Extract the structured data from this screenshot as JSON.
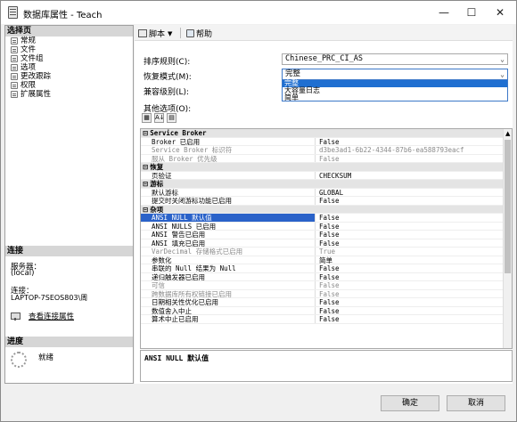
{
  "window": {
    "title": "数据库属性 - Teach",
    "min": "—",
    "max": "☐",
    "close": "✕"
  },
  "left": {
    "pages_header": "选择页",
    "pages": [
      "常规",
      "文件",
      "文件组",
      "选项",
      "更改跟踪",
      "权限",
      "扩展属性"
    ],
    "connection_header": "连接",
    "server_label": "服务器：",
    "server_value": "(local)",
    "connection_label": "连接：",
    "connection_value": "LAPTOP-7SEOS803\\周",
    "view_link": "查看连接属性",
    "progress_header": "进度",
    "status": "就绪"
  },
  "toolbar": {
    "script": "脚本",
    "help": "帮助"
  },
  "form": {
    "collation_label": "排序规则(C):",
    "collation_value": "Chinese_PRC_CI_AS",
    "recovery_label": "恢复模式(M):",
    "recovery_value": "完整",
    "compat_label": "兼容级别(L):",
    "other_label": "其他选项(O):",
    "recovery_options": [
      "完整",
      "大容量日志",
      "简单"
    ]
  },
  "grid": [
    {
      "cat": "Service Broker"
    },
    {
      "k": "Broker 已启用",
      "v": "False"
    },
    {
      "k": "Service Broker 标识符",
      "v": "d3be3ad1-6b22-4344-87b6-ea588793eacf",
      "dim": true
    },
    {
      "k": "服从 Broker 优先级",
      "v": "False",
      "dim": true
    },
    {
      "cat": "恢复"
    },
    {
      "k": "页验证",
      "v": "CHECKSUM"
    },
    {
      "cat": "游标"
    },
    {
      "k": "默认游标",
      "v": "GLOBAL"
    },
    {
      "k": "提交时关闭游标功能已启用",
      "v": "False"
    },
    {
      "cat": "杂项"
    },
    {
      "k": "ANSI NULL 默认值",
      "v": "False",
      "sel": true
    },
    {
      "k": "ANSI NULLS 已启用",
      "v": "False"
    },
    {
      "k": "ANSI 警告已启用",
      "v": "False"
    },
    {
      "k": "ANSI 填充已启用",
      "v": "False"
    },
    {
      "k": "VarDecimal 存储格式已启用",
      "v": "True",
      "dim": true
    },
    {
      "k": "参数化",
      "v": "简单"
    },
    {
      "k": "串联的 Null 结果为 Null",
      "v": "False"
    },
    {
      "k": "递归触发器已启用",
      "v": "False"
    },
    {
      "k": "可信",
      "v": "False",
      "dim": true
    },
    {
      "k": "跨数据库所有权链接已启用",
      "v": "False",
      "dim": true
    },
    {
      "k": "日期相关性优化已启用",
      "v": "False"
    },
    {
      "k": "数值舍入中止",
      "v": "False"
    },
    {
      "k": "算术中止已启用",
      "v": "False"
    }
  ],
  "description": "ANSI NULL 默认值",
  "buttons": {
    "ok": "确定",
    "cancel": "取消"
  }
}
